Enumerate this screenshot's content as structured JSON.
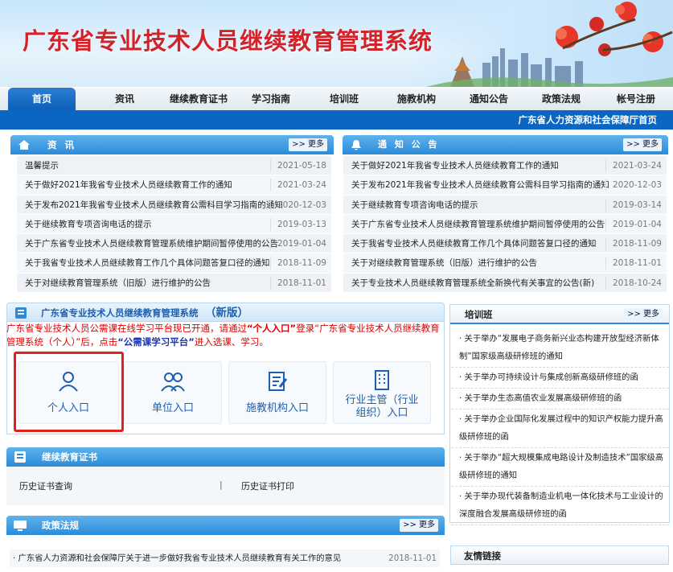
{
  "site_title": "广东省专业技术人员继续教育管理系统",
  "nav": {
    "items": [
      "首页",
      "资讯",
      "继续教育证书",
      "学习指南",
      "培训班",
      "施教机构",
      "通知公告",
      "政策法规",
      "帐号注册"
    ],
    "active": "首页"
  },
  "subbar": {
    "org": "广东省人力资源和社会保障厅首页"
  },
  "news": {
    "title": "资 讯",
    "more": ">> 更多",
    "items": [
      {
        "t": "温馨提示",
        "d": "2021-05-18"
      },
      {
        "t": "关于做好2021年我省专业技术人员继续教育工作的通知",
        "d": "2021-03-24"
      },
      {
        "t": "关于发布2021年我省专业技术人员继续教育公需科目学习指南的通知",
        "d": "2020-12-03"
      },
      {
        "t": "关于继续教育专项咨询电话的提示",
        "d": "2019-03-13"
      },
      {
        "t": "关于广东省专业技术人员继续教育管理系统维护期间暂停使用的公告",
        "d": "2019-01-04"
      },
      {
        "t": "关于我省专业技术人员继续教育工作几个具体问题答复口径的通知",
        "d": "2018-11-09"
      },
      {
        "t": "关于对继续教育管理系统（旧版）进行维护的公告",
        "d": "2018-11-01"
      }
    ]
  },
  "notices": {
    "title": "通 知 公 告",
    "more": ">> 更多",
    "items": [
      {
        "t": "关于做好2021年我省专业技术人员继续教育工作的通知",
        "d": "2021-03-24"
      },
      {
        "t": "关于发布2021年我省专业技术人员继续教育公需科目学习指南的通知",
        "d": "2020-12-03"
      },
      {
        "t": "关于继续教育专项咨询电话的提示",
        "d": "2019-03-14"
      },
      {
        "t": "关于广东省专业技术人员继续教育管理系统维护期间暂停使用的公告",
        "d": "2019-01-04"
      },
      {
        "t": "关于我省专业技术人员继续教育工作几个具体问题答复口径的通知",
        "d": "2018-11-09"
      },
      {
        "t": "关于对继续教育管理系统（旧版）进行维护的公告",
        "d": "2018-11-01"
      },
      {
        "t": "关于专业技术人员继续教育管理系统全新换代有关事宜的公告(新)",
        "d": "2018-10-24"
      }
    ]
  },
  "newsys": {
    "title": "广东省专业技术人员继续教育管理系统",
    "badge": "（新版）",
    "notice_p1": "广东省专业技术人员公需课在线学习平台现已开通，请通过",
    "notice_k1": "“个人入口”",
    "notice_p2": "登录",
    "notice_k2": "“广东省专业技术人员继续教育管理系统（个人）”",
    "notice_p3": "后，点击",
    "notice_k3": "“公需课学习平台”",
    "notice_p4": "进入选课、学习。",
    "cards": [
      "个人入口",
      "单位入口",
      "施教机构入口",
      "行业主管（行业组织）入口"
    ]
  },
  "training": {
    "title": "培训班",
    "more": ">> 更多",
    "items": [
      "· 关于举办“发展电子商务新兴业态构建开放型经济新体制”国家级高级研修班的通知",
      "· 关于举办可持续设计与集成创新高级研修班的函",
      "· 关于举办生态高值农业发展高级研修班的函",
      "· 关于举办企业国际化发展过程中的知识产权能力提升高级研修班的函",
      "· 关于举办“超大规模集成电路设计及制造技术”国家级高级研修班的通知",
      "· 关于举办现代装备制造业机电一体化技术与工业设计的深度融合发展高级研修班的函"
    ]
  },
  "cert": {
    "title": "继续教育证书",
    "link1": "历史证书查询",
    "divider": "|",
    "link2": "历史证书打印"
  },
  "policy": {
    "title": "政策法规",
    "more": ">> 更多",
    "items": [
      {
        "t": "· 广东省人力资源和社会保障厅关于进一步做好我省专业技术人员继续教育有关工作的意见",
        "d": "2018-11-01"
      }
    ]
  },
  "links": {
    "title": "友情链接"
  },
  "colors": {
    "brand_red": "#d3232a",
    "nav_blue": "#0b66c3",
    "panel_blue": "#2b8bd8",
    "highlight_red": "#e0221f"
  }
}
